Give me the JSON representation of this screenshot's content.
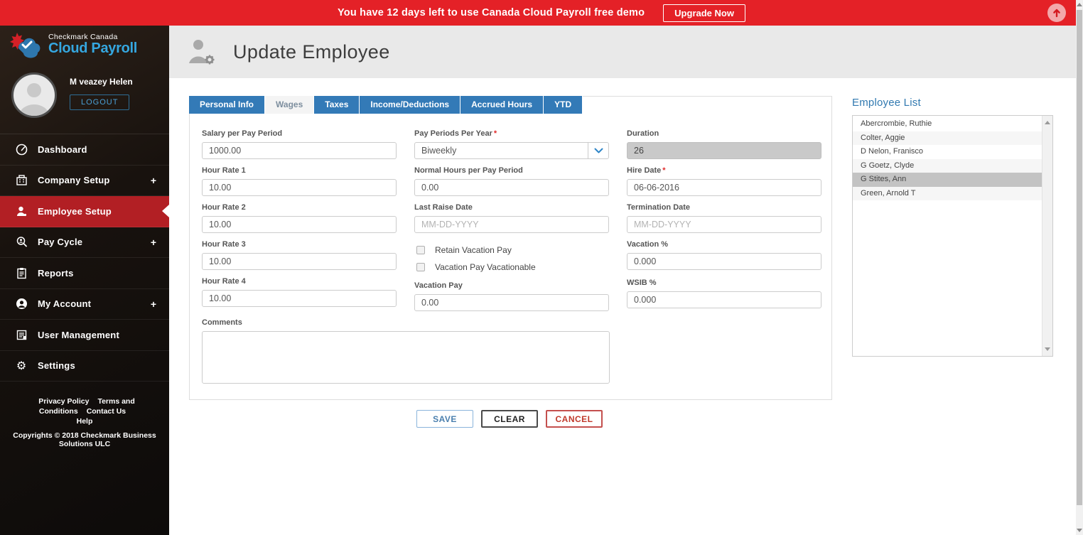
{
  "banner": {
    "message": "You have 12 days left to use Canada Cloud Payroll free demo",
    "upgrade_label": "Upgrade Now"
  },
  "brand": {
    "line1": "Checkmark Canada",
    "line2": "Cloud Payroll"
  },
  "user": {
    "name": "M veazey Helen",
    "logout_label": "LOGOUT"
  },
  "sidebar": {
    "menu": [
      {
        "label": "Dashboard",
        "icon": "dashboard-icon",
        "suffix": ""
      },
      {
        "label": "Company Setup",
        "icon": "building-icon",
        "suffix": "+"
      },
      {
        "label": "Employee Setup",
        "icon": "employee-icon",
        "suffix": "",
        "active": true
      },
      {
        "label": "Pay Cycle",
        "icon": "pay-cycle-icon",
        "suffix": "+"
      },
      {
        "label": "Reports",
        "icon": "reports-icon",
        "suffix": ""
      },
      {
        "label": "My Account",
        "icon": "account-icon",
        "suffix": "+"
      },
      {
        "label": "User Management",
        "icon": "user-management-icon",
        "suffix": ""
      },
      {
        "label": "Settings",
        "icon": "settings-icon",
        "suffix": ""
      }
    ],
    "footer": {
      "link1": "Privacy Policy",
      "link2": "Terms and Conditions",
      "link3": "Contact Us",
      "link4": "Help",
      "copyright": "Copyrights © 2018 Checkmark Business Solutions ULC"
    }
  },
  "header": {
    "title": "Update Employee"
  },
  "tabs": [
    {
      "label": "Personal Info"
    },
    {
      "label": "Wages",
      "active": true
    },
    {
      "label": "Taxes"
    },
    {
      "label": "Income/Deductions"
    },
    {
      "label": "Accrued Hours"
    },
    {
      "label": "YTD"
    }
  ],
  "form": {
    "salary": {
      "label": "Salary per Pay Period",
      "value": "1000.00"
    },
    "hour_rate_1": {
      "label": "Hour Rate 1",
      "value": "10.00"
    },
    "hour_rate_2": {
      "label": "Hour Rate 2",
      "value": "10.00"
    },
    "hour_rate_3": {
      "label": "Hour Rate 3",
      "value": "10.00"
    },
    "hour_rate_4": {
      "label": "Hour Rate 4",
      "value": "10.00"
    },
    "comments": {
      "label": "Comments",
      "value": ""
    },
    "pay_periods": {
      "label": "Pay Periods Per Year",
      "required": true,
      "value": "Biweekly"
    },
    "normal_hours": {
      "label": "Normal Hours per Pay Period",
      "value": "0.00"
    },
    "last_raise": {
      "label": "Last Raise Date",
      "placeholder": "MM-DD-YYYY"
    },
    "retain_vacation": {
      "label": "Retain Vacation Pay",
      "checked": false
    },
    "vacation_vacationable": {
      "label": "Vacation Pay Vacationable",
      "checked": false
    },
    "vacation_pay": {
      "label": "Vacation Pay",
      "value": "0.00"
    },
    "duration": {
      "label": "Duration",
      "value": "26",
      "disabled": true
    },
    "hire_date": {
      "label": "Hire Date",
      "required": true,
      "value": "06-06-2016"
    },
    "termination_date": {
      "label": "Termination Date",
      "placeholder": "MM-DD-YYYY"
    },
    "vacation_pct": {
      "label": "Vacation %",
      "value": "0.000"
    },
    "wsib_pct": {
      "label": "WSIB %",
      "value": "0.000"
    }
  },
  "actions": {
    "save": "SAVE",
    "clear": "CLEAR",
    "cancel": "CANCEL"
  },
  "employee_list": {
    "title": "Employee List",
    "items": [
      "Abercrombie, Ruthie",
      "Colter, Aggie",
      "D Nelon, Franisco",
      "G Goetz, Clyde",
      "G Stites, Ann",
      "Green, Arnold T"
    ],
    "selected": "G Stites, Ann"
  },
  "misc": {
    "required_marker": "*"
  },
  "colors": {
    "banner_red": "#e42127",
    "active_menu_red": "#b21f24",
    "tab_blue": "#337ab7",
    "logo_blue": "#35a7e0",
    "selected_row_gray": "#c3c3c3"
  }
}
